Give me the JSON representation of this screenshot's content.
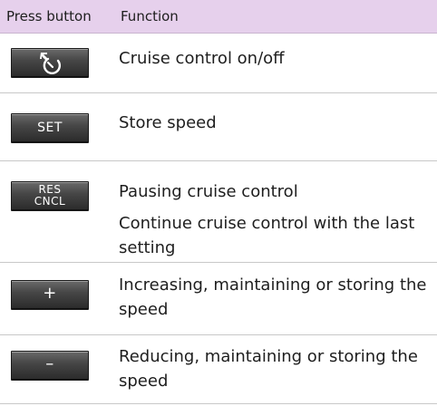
{
  "table": {
    "header": {
      "col_button": "Press button",
      "col_function": "Function"
    },
    "rows": [
      {
        "button": {
          "icon": "cruise-control-icon"
        },
        "functions": [
          "Cruise control on/off"
        ]
      },
      {
        "button": {
          "label": "SET"
        },
        "functions": [
          "Store speed"
        ]
      },
      {
        "button": {
          "label_line1": "RES",
          "label_line2": "CNCL"
        },
        "functions": [
          "Pausing cruise control",
          "Continue cruise control with the last setting"
        ]
      },
      {
        "button": {
          "label": "+"
        },
        "functions": [
          "Increasing, maintaining or storing the speed"
        ]
      },
      {
        "button": {
          "label": "–"
        },
        "functions": [
          "Reducing, maintaining or storing the speed"
        ]
      }
    ]
  },
  "colors": {
    "header_background": "#e6d0ec",
    "row_divider": "#c8c8c8",
    "button_face": "#3a3a3a",
    "button_text": "#ffffff"
  }
}
